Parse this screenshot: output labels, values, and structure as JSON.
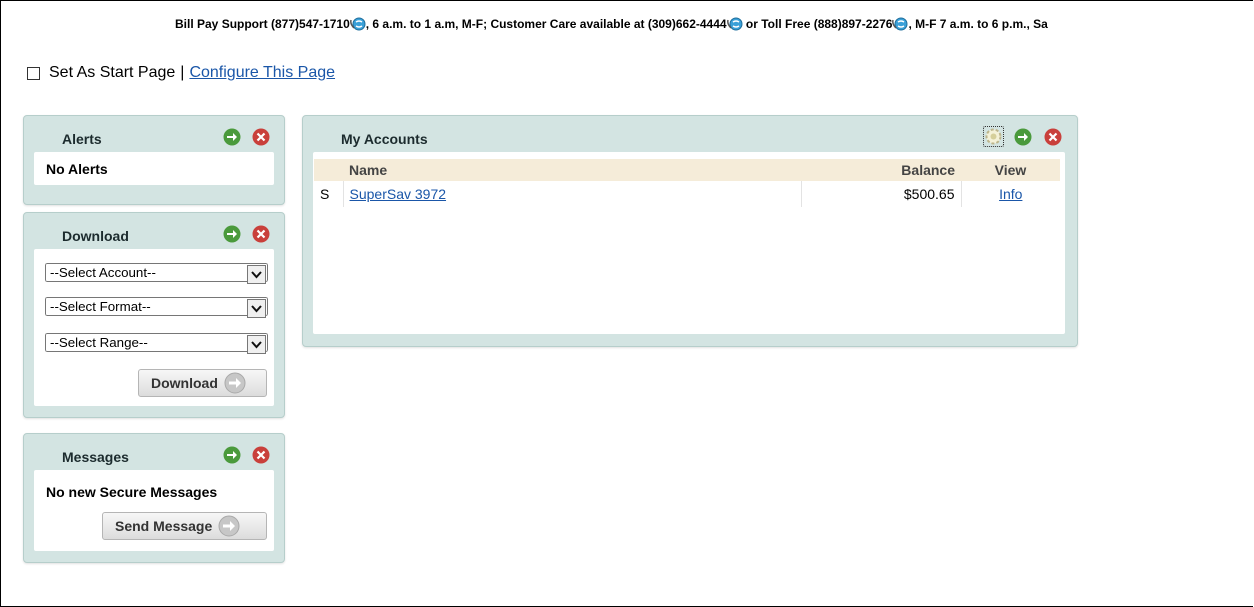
{
  "support": {
    "seg1": "Bill Pay Support (877)547-1710",
    "seg2": ", 6 a.m. to 1 a.m, M-F; Customer Care available at (309)662-4444",
    "seg3": " or Toll Free (888)897-2276",
    "seg4": ", M-F 7 a.m. to 6 p.m., Sa"
  },
  "start": {
    "label": "Set As Start Page",
    "sep": "|",
    "configure": "Configure This Page"
  },
  "alerts": {
    "title": "Alerts",
    "body": "No Alerts"
  },
  "download": {
    "title": "Download",
    "account_placeholder": "--Select Account--",
    "format_placeholder": "--Select Format--",
    "range_placeholder": "--Select Range--",
    "button": "Download"
  },
  "messages": {
    "title": "Messages",
    "body": "No new Secure Messages",
    "button": "Send Message"
  },
  "accounts": {
    "title": "My Accounts",
    "columns": {
      "name": "Name",
      "balance": "Balance",
      "view": "View"
    },
    "rows": [
      {
        "type": "S",
        "name": "SuperSav 3972",
        "balance": "$500.65",
        "view": "Info"
      }
    ]
  }
}
